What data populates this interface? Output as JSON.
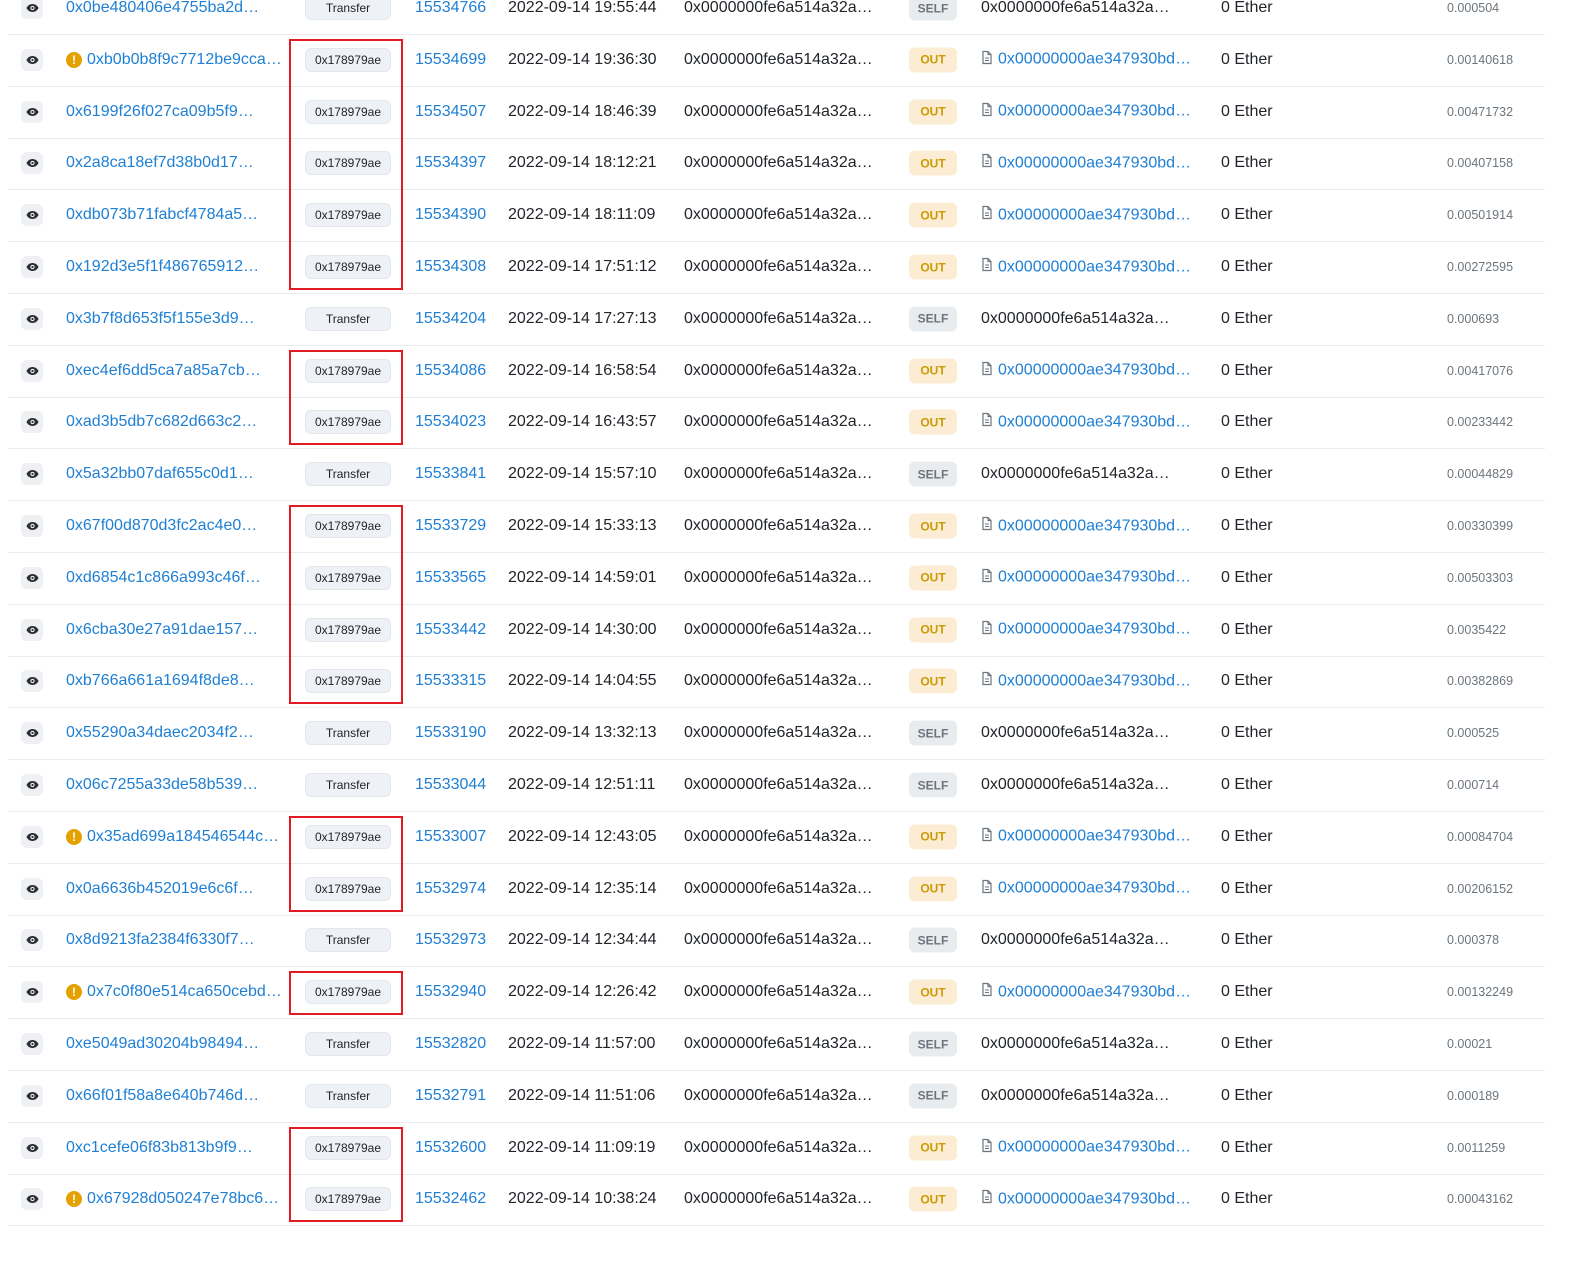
{
  "colors": {
    "link": "#1e7fd4",
    "out_badge_bg": "#fbecd3",
    "out_badge_text": "#cc9a06",
    "self_badge_bg": "#e9ecef",
    "highlight": "#e11b22",
    "warning": "#e5a100"
  },
  "icons": {
    "view": "eye-icon",
    "warning": "exclamation-circle-icon",
    "contract": "document-icon"
  },
  "rows": [
    {
      "hash": "0x0be480406e4755ba2d…",
      "method": "Transfer",
      "block": "15534766",
      "age": "2022-09-14 19:55:44",
      "from": "0x0000000fe6a514a32a…",
      "dir": "SELF",
      "to": "0x0000000fe6a514a32a…",
      "value": "0 Ether",
      "fee": "0.000504",
      "warn": false,
      "to_contract": false
    },
    {
      "hash": "0xb0b0b8f9c7712be9cca…",
      "method": "0x178979ae",
      "block": "15534699",
      "age": "2022-09-14 19:36:30",
      "from": "0x0000000fe6a514a32a…",
      "dir": "OUT",
      "to": "0x00000000ae347930bd…",
      "value": "0 Ether",
      "fee": "0.00140618",
      "warn": true,
      "to_contract": true
    },
    {
      "hash": "0x6199f26f027ca09b5f9…",
      "method": "0x178979ae",
      "block": "15534507",
      "age": "2022-09-14 18:46:39",
      "from": "0x0000000fe6a514a32a…",
      "dir": "OUT",
      "to": "0x00000000ae347930bd…",
      "value": "0 Ether",
      "fee": "0.00471732",
      "warn": false,
      "to_contract": true
    },
    {
      "hash": "0x2a8ca18ef7d38b0d17…",
      "method": "0x178979ae",
      "block": "15534397",
      "age": "2022-09-14 18:12:21",
      "from": "0x0000000fe6a514a32a…",
      "dir": "OUT",
      "to": "0x00000000ae347930bd…",
      "value": "0 Ether",
      "fee": "0.00407158",
      "warn": false,
      "to_contract": true
    },
    {
      "hash": "0xdb073b71fabcf4784a5…",
      "method": "0x178979ae",
      "block": "15534390",
      "age": "2022-09-14 18:11:09",
      "from": "0x0000000fe6a514a32a…",
      "dir": "OUT",
      "to": "0x00000000ae347930bd…",
      "value": "0 Ether",
      "fee": "0.00501914",
      "warn": false,
      "to_contract": true
    },
    {
      "hash": "0x192d3e5f1f486765912…",
      "method": "0x178979ae",
      "block": "15534308",
      "age": "2022-09-14 17:51:12",
      "from": "0x0000000fe6a514a32a…",
      "dir": "OUT",
      "to": "0x00000000ae347930bd…",
      "value": "0 Ether",
      "fee": "0.00272595",
      "warn": false,
      "to_contract": true
    },
    {
      "hash": "0x3b7f8d653f5f155e3d9…",
      "method": "Transfer",
      "block": "15534204",
      "age": "2022-09-14 17:27:13",
      "from": "0x0000000fe6a514a32a…",
      "dir": "SELF",
      "to": "0x0000000fe6a514a32a…",
      "value": "0 Ether",
      "fee": "0.000693",
      "warn": false,
      "to_contract": false
    },
    {
      "hash": "0xec4ef6dd5ca7a85a7cb…",
      "method": "0x178979ae",
      "block": "15534086",
      "age": "2022-09-14 16:58:54",
      "from": "0x0000000fe6a514a32a…",
      "dir": "OUT",
      "to": "0x00000000ae347930bd…",
      "value": "0 Ether",
      "fee": "0.00417076",
      "warn": false,
      "to_contract": true
    },
    {
      "hash": "0xad3b5db7c682d663c2…",
      "method": "0x178979ae",
      "block": "15534023",
      "age": "2022-09-14 16:43:57",
      "from": "0x0000000fe6a514a32a…",
      "dir": "OUT",
      "to": "0x00000000ae347930bd…",
      "value": "0 Ether",
      "fee": "0.00233442",
      "warn": false,
      "to_contract": true
    },
    {
      "hash": "0x5a32bb07daf655c0d1…",
      "method": "Transfer",
      "block": "15533841",
      "age": "2022-09-14 15:57:10",
      "from": "0x0000000fe6a514a32a…",
      "dir": "SELF",
      "to": "0x0000000fe6a514a32a…",
      "value": "0 Ether",
      "fee": "0.00044829",
      "warn": false,
      "to_contract": false
    },
    {
      "hash": "0x67f00d870d3fc2ac4e0…",
      "method": "0x178979ae",
      "block": "15533729",
      "age": "2022-09-14 15:33:13",
      "from": "0x0000000fe6a514a32a…",
      "dir": "OUT",
      "to": "0x00000000ae347930bd…",
      "value": "0 Ether",
      "fee": "0.00330399",
      "warn": false,
      "to_contract": true
    },
    {
      "hash": "0xd6854c1c866a993c46f…",
      "method": "0x178979ae",
      "block": "15533565",
      "age": "2022-09-14 14:59:01",
      "from": "0x0000000fe6a514a32a…",
      "dir": "OUT",
      "to": "0x00000000ae347930bd…",
      "value": "0 Ether",
      "fee": "0.00503303",
      "warn": false,
      "to_contract": true
    },
    {
      "hash": "0x6cba30e27a91dae157…",
      "method": "0x178979ae",
      "block": "15533442",
      "age": "2022-09-14 14:30:00",
      "from": "0x0000000fe6a514a32a…",
      "dir": "OUT",
      "to": "0x00000000ae347930bd…",
      "value": "0 Ether",
      "fee": "0.0035422",
      "warn": false,
      "to_contract": true
    },
    {
      "hash": "0xb766a661a1694f8de8…",
      "method": "0x178979ae",
      "block": "15533315",
      "age": "2022-09-14 14:04:55",
      "from": "0x0000000fe6a514a32a…",
      "dir": "OUT",
      "to": "0x00000000ae347930bd…",
      "value": "0 Ether",
      "fee": "0.00382869",
      "warn": false,
      "to_contract": true
    },
    {
      "hash": "0x55290a34daec2034f2…",
      "method": "Transfer",
      "block": "15533190",
      "age": "2022-09-14 13:32:13",
      "from": "0x0000000fe6a514a32a…",
      "dir": "SELF",
      "to": "0x0000000fe6a514a32a…",
      "value": "0 Ether",
      "fee": "0.000525",
      "warn": false,
      "to_contract": false
    },
    {
      "hash": "0x06c7255a33de58b539…",
      "method": "Transfer",
      "block": "15533044",
      "age": "2022-09-14 12:51:11",
      "from": "0x0000000fe6a514a32a…",
      "dir": "SELF",
      "to": "0x0000000fe6a514a32a…",
      "value": "0 Ether",
      "fee": "0.000714",
      "warn": false,
      "to_contract": false
    },
    {
      "hash": "0x35ad699a184546544c…",
      "method": "0x178979ae",
      "block": "15533007",
      "age": "2022-09-14 12:43:05",
      "from": "0x0000000fe6a514a32a…",
      "dir": "OUT",
      "to": "0x00000000ae347930bd…",
      "value": "0 Ether",
      "fee": "0.00084704",
      "warn": true,
      "to_contract": true
    },
    {
      "hash": "0x0a6636b452019e6c6f…",
      "method": "0x178979ae",
      "block": "15532974",
      "age": "2022-09-14 12:35:14",
      "from": "0x0000000fe6a514a32a…",
      "dir": "OUT",
      "to": "0x00000000ae347930bd…",
      "value": "0 Ether",
      "fee": "0.00206152",
      "warn": false,
      "to_contract": true
    },
    {
      "hash": "0x8d9213fa2384f6330f7…",
      "method": "Transfer",
      "block": "15532973",
      "age": "2022-09-14 12:34:44",
      "from": "0x0000000fe6a514a32a…",
      "dir": "SELF",
      "to": "0x0000000fe6a514a32a…",
      "value": "0 Ether",
      "fee": "0.000378",
      "warn": false,
      "to_contract": false
    },
    {
      "hash": "0x7c0f80e514ca650cebd…",
      "method": "0x178979ae",
      "block": "15532940",
      "age": "2022-09-14 12:26:42",
      "from": "0x0000000fe6a514a32a…",
      "dir": "OUT",
      "to": "0x00000000ae347930bd…",
      "value": "0 Ether",
      "fee": "0.00132249",
      "warn": true,
      "to_contract": true
    },
    {
      "hash": "0xe5049ad30204b98494…",
      "method": "Transfer",
      "block": "15532820",
      "age": "2022-09-14 11:57:00",
      "from": "0x0000000fe6a514a32a…",
      "dir": "SELF",
      "to": "0x0000000fe6a514a32a…",
      "value": "0 Ether",
      "fee": "0.00021",
      "warn": false,
      "to_contract": false
    },
    {
      "hash": "0x66f01f58a8e640b746d…",
      "method": "Transfer",
      "block": "15532791",
      "age": "2022-09-14 11:51:06",
      "from": "0x0000000fe6a514a32a…",
      "dir": "SELF",
      "to": "0x0000000fe6a514a32a…",
      "value": "0 Ether",
      "fee": "0.000189",
      "warn": false,
      "to_contract": false
    },
    {
      "hash": "0xc1cefe06f83b813b9f9…",
      "method": "0x178979ae",
      "block": "15532600",
      "age": "2022-09-14 11:09:19",
      "from": "0x0000000fe6a514a32a…",
      "dir": "OUT",
      "to": "0x00000000ae347930bd…",
      "value": "0 Ether",
      "fee": "0.0011259",
      "warn": false,
      "to_contract": true
    },
    {
      "hash": "0x67928d050247e78bc6…",
      "method": "0x178979ae",
      "block": "15532462",
      "age": "2022-09-14 10:38:24",
      "from": "0x0000000fe6a514a32a…",
      "dir": "OUT",
      "to": "0x00000000ae347930bd…",
      "value": "0 Ether",
      "fee": "0.00043162",
      "warn": true,
      "to_contract": true
    }
  ],
  "highlight_groups": [
    [
      1,
      5
    ],
    [
      7,
      8
    ],
    [
      10,
      13
    ],
    [
      16,
      17
    ],
    [
      19,
      19
    ],
    [
      22,
      23
    ]
  ]
}
